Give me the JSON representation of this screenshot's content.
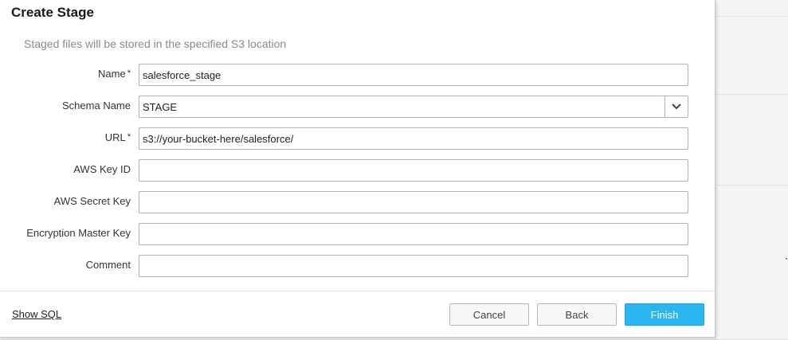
{
  "dialog": {
    "title": "Create Stage",
    "subtitle": "Staged files will be stored in the specified S3 location"
  },
  "form": {
    "name": {
      "label": "Name",
      "required_mark": "*",
      "value": "salesforce_stage"
    },
    "schema": {
      "label": "Schema Name",
      "value": "STAGE",
      "icon": "chevron-down-icon"
    },
    "url": {
      "label": "URL",
      "required_mark": "*",
      "value": "s3://your-bucket-here/salesforce/"
    },
    "aws_key_id": {
      "label": "AWS Key ID",
      "value": ""
    },
    "aws_secret_key": {
      "label": "AWS Secret Key",
      "value": ""
    },
    "encryption_master_key": {
      "label": "Encryption Master Key",
      "value": ""
    },
    "comment": {
      "label": "Comment",
      "value": ""
    }
  },
  "footer": {
    "show_sql_label": "Show SQL",
    "cancel_label": "Cancel",
    "back_label": "Back",
    "finish_label": "Finish"
  },
  "colors": {
    "primary": "#29b5ee",
    "subtitle": "#8a8a8a",
    "border": "#b3b3b3"
  }
}
